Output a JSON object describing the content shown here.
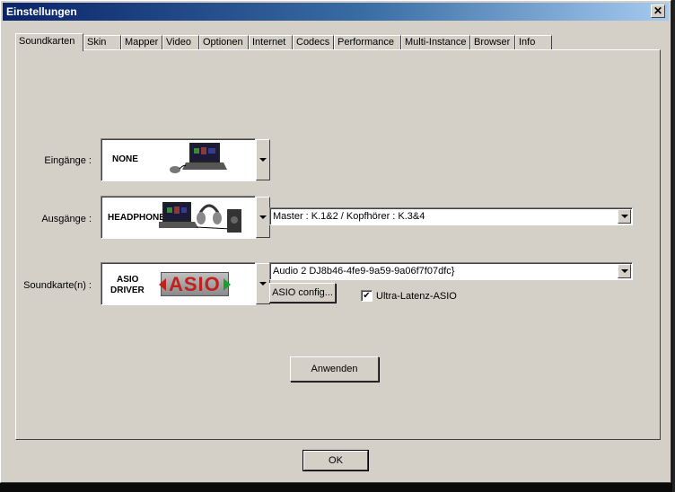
{
  "window": {
    "title": "Einstellungen",
    "close_glyph": "✕"
  },
  "tabs": [
    {
      "label": "Soundkarten",
      "active": true
    },
    {
      "label": "Skin"
    },
    {
      "label": "Mapper"
    },
    {
      "label": "Video"
    },
    {
      "label": "Optionen"
    },
    {
      "label": "Internet"
    },
    {
      "label": "Codecs"
    },
    {
      "label": "Performance"
    },
    {
      "label": "Multi-Instance"
    },
    {
      "label": "Browser"
    },
    {
      "label": "Info"
    }
  ],
  "inputs": {
    "label": "Eingänge :",
    "selected": "NONE",
    "icon": "laptop-mouse-icon"
  },
  "outputs": {
    "label": "Ausgänge :",
    "selected": "HEADPHONES",
    "icon": "laptop-headphones-icon",
    "routing": "Master : K.1&2 / Kopfhörer : K.3&4"
  },
  "soundcard": {
    "label": "Soundkarte(n) :",
    "selected_line1": "ASIO",
    "selected_line2": "DRIVER",
    "logo_text": "ASIO",
    "device": "Audio 2 DJ8b46-4fe9-9a59-9a06f7f07dfc}",
    "config_button": "ASIO config...",
    "ultra_latency_label": "Ultra-Latenz-ASIO",
    "ultra_latency_checked": true,
    "check_glyph": "✔"
  },
  "buttons": {
    "apply": "Anwenden",
    "ok": "OK"
  },
  "colors": {
    "titlebar_start": "#0a246a",
    "titlebar_end": "#a6caf0",
    "face": "#d4d0c8",
    "asio_red": "#c0201e",
    "asio_green": "#1aa028"
  }
}
